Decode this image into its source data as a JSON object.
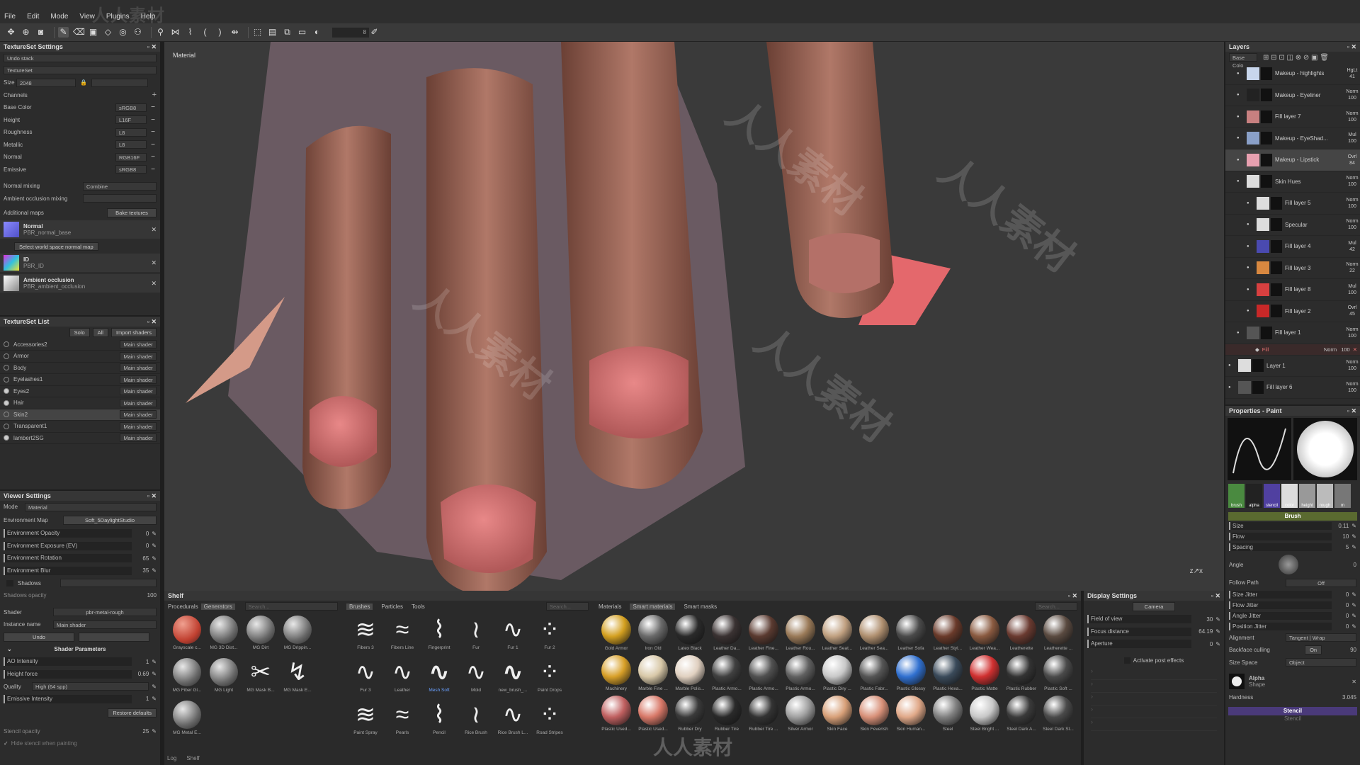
{
  "menu": [
    "File",
    "Edit",
    "Mode",
    "View",
    "Plugins",
    "Help"
  ],
  "toolbar": {
    "size_value": "8"
  },
  "textureset_settings": {
    "title": "TextureSet Settings",
    "undo": "Undo stack",
    "textureset": "TextureSet",
    "size_label": "Size",
    "size_value": "2048",
    "channels_label": "Channels",
    "channels": [
      {
        "name": "Base Color",
        "fmt": "sRGB8"
      },
      {
        "name": "Height",
        "fmt": "L16F"
      },
      {
        "name": "Roughness",
        "fmt": "L8"
      },
      {
        "name": "Metallic",
        "fmt": "L8"
      },
      {
        "name": "Normal",
        "fmt": "RGB16F"
      },
      {
        "name": "Emissive",
        "fmt": "sRGB8"
      }
    ],
    "normal_mixing_label": "Normal mixing",
    "normal_mixing_value": "Combine",
    "ao_mixing_label": "Ambient occlusion mixing",
    "additional_maps": "Additional maps",
    "bake_button": "Bake textures",
    "maps": [
      {
        "name": "Normal",
        "file": "PBR_normal_base"
      },
      {
        "name": "ID",
        "file": "PBR_ID"
      },
      {
        "name": "Ambient occlusion",
        "file": "PBR_ambient_occlusion"
      }
    ],
    "select_normal": "Select world space normal map"
  },
  "textureset_list": {
    "title": "TextureSet List",
    "solo": "Solo",
    "all": "All",
    "import": "Import shaders",
    "items": [
      {
        "name": "Accessories2",
        "shader": "Main shader"
      },
      {
        "name": "Armor",
        "shader": "Main shader"
      },
      {
        "name": "Body",
        "shader": "Main shader"
      },
      {
        "name": "Eyelashes1",
        "shader": "Main shader"
      },
      {
        "name": "Eyes2",
        "shader": "Main shader"
      },
      {
        "name": "Hair",
        "shader": "Main shader"
      },
      {
        "name": "Skin2",
        "shader": "Main shader"
      },
      {
        "name": "Transparent1",
        "shader": "Main shader"
      },
      {
        "name": "lambert2SG",
        "shader": "Main shader"
      }
    ]
  },
  "viewer_settings": {
    "title": "Viewer Settings",
    "mode_label": "Mode",
    "mode_value": "Material",
    "env_map_label": "Environment Map",
    "env_map_value": "Soft_5DaylightStudio",
    "sliders": [
      {
        "label": "Environment Opacity",
        "value": "0"
      },
      {
        "label": "Environment Exposure (EV)",
        "value": "0"
      },
      {
        "label": "Environment Rotation",
        "value": "65"
      },
      {
        "label": "Environment Blur",
        "value": "35"
      }
    ],
    "shadows": "Shadows",
    "shadows_opacity_label": "Shadows opacity",
    "shadows_opacity_value": "100"
  },
  "shader_settings": {
    "shader_label": "Shader",
    "shader_value": "pbr-metal-rough",
    "instance_label": "Instance name",
    "instance_value": "Main shader",
    "undo": "Undo",
    "params_title": "Shader Parameters",
    "params": [
      {
        "label": "AO Intensity",
        "value": "1"
      },
      {
        "label": "Height force",
        "value": "0.69"
      },
      {
        "label": "Quality",
        "value": "High (64 spp)"
      },
      {
        "label": "Emissive Intensity",
        "value": "1"
      }
    ],
    "restore": "Restore defaults",
    "stencil_opacity_label": "Stencil opacity",
    "stencil_opacity_value": "25",
    "hide_stencil": "Hide stencil when painting"
  },
  "viewport": {
    "label": "Material"
  },
  "layers": {
    "title": "Layers",
    "channel": "Base Colo",
    "items": [
      {
        "name": "Makeup - highlights",
        "blend": "HgLt",
        "op": "41",
        "color": "#c8d6ec"
      },
      {
        "name": "Makeup - Eyeliner",
        "blend": "Norm",
        "op": "100",
        "color": "#222"
      },
      {
        "name": "Fill layer 7",
        "blend": "Norm",
        "op": "100",
        "color": "#c88080"
      },
      {
        "name": "Makeup - EyeShad...",
        "blend": "Mul",
        "op": "100",
        "color": "#8aa0c8"
      },
      {
        "name": "Makeup - Lipstick",
        "blend": "Ovrl",
        "op": "84",
        "color": "#e8a0b0"
      },
      {
        "name": "Skin Hues",
        "blend": "Norm",
        "op": "100",
        "color": "#ddd"
      },
      {
        "name": "Fill layer 5",
        "blend": "Norm",
        "op": "100",
        "color": "#ddd"
      },
      {
        "name": "Specular",
        "blend": "Norm",
        "op": "100",
        "color": "#ddd"
      },
      {
        "name": "Fill layer 4",
        "blend": "Mul",
        "op": "42",
        "color": "#4a4ab0"
      },
      {
        "name": "Fill layer 3",
        "blend": "Norm",
        "op": "22",
        "color": "#d88840"
      },
      {
        "name": "Fill layer 8",
        "blend": "Mul",
        "op": "100",
        "color": "#d84040"
      },
      {
        "name": "Fill layer 2",
        "blend": "Ovrl",
        "op": "45",
        "color": "#c82828"
      },
      {
        "name": "Fill layer 1",
        "blend": "Norm",
        "op": "100",
        "color": "#555"
      },
      {
        "name": "Layer 1",
        "blend": "Norm",
        "op": "100",
        "color": "#ddd"
      },
      {
        "name": "Fill layer 6",
        "blend": "Norm",
        "op": "100",
        "color": "#555"
      }
    ],
    "fill_sub": {
      "name": "Fill",
      "blend": "Norm",
      "op": "100"
    }
  },
  "properties": {
    "title": "Properties - Paint",
    "thumbs": [
      "brush",
      "alpha",
      "stencil",
      "color",
      "height",
      "rough",
      "m"
    ],
    "brush_title": "Brush",
    "params": [
      {
        "label": "Size",
        "value": "0.11"
      },
      {
        "label": "Flow",
        "value": "10"
      },
      {
        "label": "Spacing",
        "value": "5"
      }
    ],
    "angle_label": "Angle",
    "angle_value": "0",
    "follow_path_label": "Follow Path",
    "follow_path_value": "Off",
    "jitters": [
      {
        "label": "Size Jitter",
        "value": "0"
      },
      {
        "label": "Flow Jitter",
        "value": "0"
      },
      {
        "label": "Angle Jitter",
        "value": "0"
      },
      {
        "label": "Position Jitter",
        "value": "0"
      }
    ],
    "alignment_label": "Alignment",
    "alignment_value": "Tangent | Wrap",
    "backface_label": "Backface culling",
    "backface_on": "On",
    "backface_value": "90",
    "size_space_label": "Size Space",
    "size_space_value": "Object",
    "alpha_label": "Alpha",
    "alpha_shape": "Shape",
    "hardness_label": "Hardness",
    "hardness_value": "3.045",
    "stencil_title": "Stencil",
    "stencil_sub": "Stencil"
  },
  "shelf": {
    "title": "Shelf",
    "tabs1": [
      "Procedurals",
      "Generators"
    ],
    "search": "Search...",
    "generators": [
      "Grayscale c...",
      "MG 3D Dist...",
      "MG Dirt",
      "MG Drippin...",
      "MG Fiber Gl...",
      "MG Light",
      "MG Mask B...",
      "MG Mask E...",
      "MG Metal E..."
    ],
    "tabs2": [
      "Brushes",
      "Particles",
      "Tools"
    ],
    "brushes": [
      "Fibers 3",
      "Fibers Line",
      "Fingerprint",
      "Fur",
      "Fur 1",
      "Fur 2",
      "Fur 3",
      "Leather",
      "Mesh Soft",
      "Mold",
      "new_brush_...",
      "Paint Drops",
      "Paint Spray",
      "Pearls",
      "Pencil",
      "Rice Brush",
      "Rice Brush L...",
      "Road Stripes"
    ],
    "tabs3": [
      "Materials",
      "Smart materials",
      "Smart masks"
    ],
    "materials": [
      {
        "n": "Gold Armor",
        "c": "#d4a020"
      },
      {
        "n": "Iron Old",
        "c": "#6a6a6a"
      },
      {
        "n": "Latex Black",
        "c": "#2a2a2a"
      },
      {
        "n": "Leather Da...",
        "c": "#3a3232"
      },
      {
        "n": "Leather Fine...",
        "c": "#5a3a30"
      },
      {
        "n": "Leather Rou...",
        "c": "#9a7a58"
      },
      {
        "n": "Leather Seat...",
        "c": "#c0a080"
      },
      {
        "n": "Leather Sea...",
        "c": "#b09070"
      },
      {
        "n": "Leather Sofa",
        "c": "#4a4a4a"
      },
      {
        "n": "Leather Styl...",
        "c": "#6a3a2a"
      },
      {
        "n": "Leather Wea...",
        "c": "#8a5a40"
      },
      {
        "n": "Leatherette",
        "c": "#6a3a30"
      },
      {
        "n": "Leatherette ...",
        "c": "#5a4a40"
      },
      {
        "n": "Machinery",
        "c": "#d8a028"
      },
      {
        "n": "Marble Fine ...",
        "c": "#d8c8a8"
      },
      {
        "n": "Marble Polis...",
        "c": "#e0d0c0"
      },
      {
        "n": "Plastic Armo...",
        "c": "#404040"
      },
      {
        "n": "Plastic Armo...",
        "c": "#505050"
      },
      {
        "n": "Plastic Armo...",
        "c": "#606060"
      },
      {
        "n": "Plastic Diry ...",
        "c": "#c8c8c8"
      },
      {
        "n": "Plastic Fabr...",
        "c": "#555"
      },
      {
        "n": "Plastic Glossy",
        "c": "#3070d0"
      },
      {
        "n": "Plastic Hexa...",
        "c": "#3a4a5a"
      },
      {
        "n": "Plastic Matte",
        "c": "#d03030"
      },
      {
        "n": "Plastic Rubber",
        "c": "#333"
      },
      {
        "n": "Plastic Soft ...",
        "c": "#4a4a4a"
      },
      {
        "n": "Plastic Used...",
        "c": "#c06060"
      },
      {
        "n": "Plastic Used...",
        "c": "#d87868"
      },
      {
        "n": "Rubber Dry",
        "c": "#3a3a3a"
      },
      {
        "n": "Rubber Tire",
        "c": "#2a2a2a"
      },
      {
        "n": "Rubber Tire ...",
        "c": "#333"
      },
      {
        "n": "Silver Armor",
        "c": "#a0a0a0"
      },
      {
        "n": "Skin Face",
        "c": "#d8a078"
      },
      {
        "n": "Skin Feverish",
        "c": "#d89078"
      },
      {
        "n": "Skin Human...",
        "c": "#e0a888"
      },
      {
        "n": "Steel",
        "c": "#808080"
      },
      {
        "n": "Steel Bright ...",
        "c": "#c8c8c8"
      },
      {
        "n": "Steel Dark A...",
        "c": "#3a3a3a"
      },
      {
        "n": "Steel Dark St...",
        "c": "#4a4a4a"
      }
    ],
    "bottom": [
      "Log",
      "Shelf"
    ]
  },
  "display_settings": {
    "title": "Display Settings",
    "camera": "Camera",
    "params": [
      {
        "label": "Field of view",
        "value": "30"
      },
      {
        "label": "Focus distance",
        "value": "64.19"
      },
      {
        "label": "Aperture",
        "value": "0"
      }
    ],
    "post_effects": "Activate post effects"
  },
  "watermark": {
    "logo": "人人素材",
    "footer": "人人素材"
  }
}
